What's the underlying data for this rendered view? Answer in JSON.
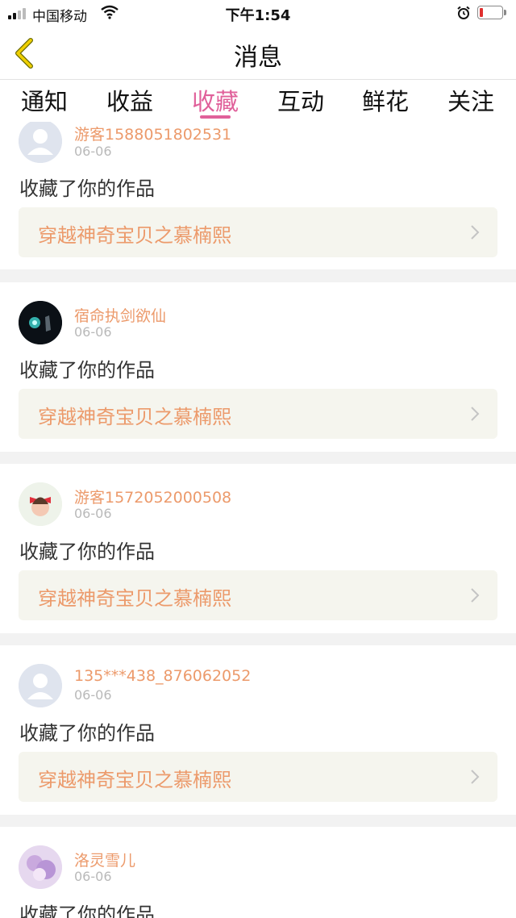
{
  "status": {
    "carrier": "中国移动",
    "time": "下午1:54"
  },
  "nav": {
    "title": "消息"
  },
  "tabs": [
    {
      "label": "通知"
    },
    {
      "label": "收益"
    },
    {
      "label": "收藏"
    },
    {
      "label": "互动"
    },
    {
      "label": "鲜花"
    },
    {
      "label": "关注"
    }
  ],
  "active_tab": "收藏",
  "colors": {
    "accent_pink": "#e0609a",
    "username_orange": "#ec9a6b",
    "work_box_bg": "#f5f5ee"
  },
  "items": [
    {
      "user": "游客1588051802531",
      "date": "06-06",
      "action": "收藏了你的作品",
      "work": "穿越神奇宝贝之慕楠熙",
      "avatar": "default-avatar-icon"
    },
    {
      "user": "宿命执剑欲仙",
      "date": "06-06",
      "action": "收藏了你的作品",
      "work": "穿越神奇宝贝之慕楠熙",
      "avatar": "dark-glow-avatar"
    },
    {
      "user": "游客1572052000508",
      "date": "06-06",
      "action": "收藏了你的作品",
      "work": "穿越神奇宝贝之慕楠熙",
      "avatar": "girl-bow-avatar"
    },
    {
      "user": "135***438_876062052",
      "date": "06-06",
      "action": "收藏了你的作品",
      "work": "穿越神奇宝贝之慕楠熙",
      "avatar": "default-avatar-icon"
    },
    {
      "user": "洛灵雪儿",
      "date": "06-06",
      "action": "收藏了你的作品",
      "work": "",
      "avatar": "anime-avatar"
    }
  ]
}
